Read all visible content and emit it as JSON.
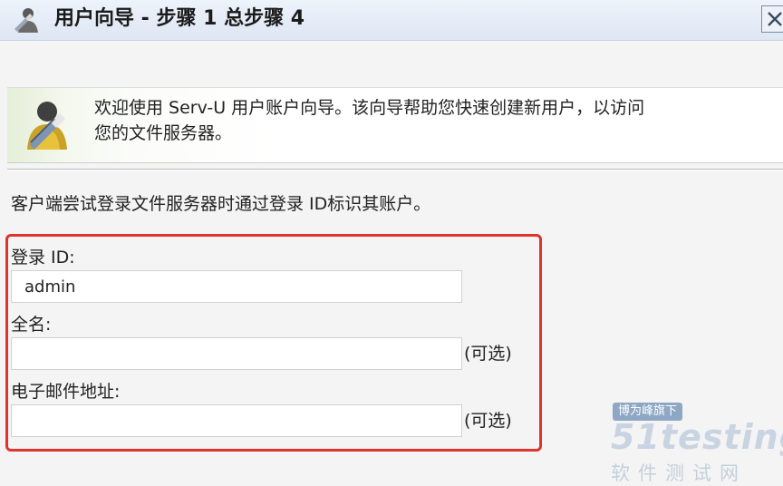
{
  "window": {
    "title": "用户向导 - 步骤 1 总步骤 4"
  },
  "banner": {
    "line1": "欢迎使用 Serv-U 用户账户向导。该向导帮助您快速创建新用户，以访问",
    "line2": "您的文件服务器。"
  },
  "instruction": "客户端尝试登录文件服务器时通过登录 ID标识其账户。",
  "form": {
    "login_id": {
      "label": "登录 ID:",
      "value": "admin"
    },
    "full_name": {
      "label": "全名:",
      "value": "",
      "optional": "(可选)"
    },
    "email": {
      "label": "电子邮件地址:",
      "value": "",
      "optional": "(可选)"
    }
  },
  "watermark": {
    "tag": "博为峰旗下",
    "logo": "51testing",
    "sub": "软件测试网"
  },
  "colors": {
    "highlight_frame": "#e0322e",
    "titlebar": "#dde6f3"
  }
}
